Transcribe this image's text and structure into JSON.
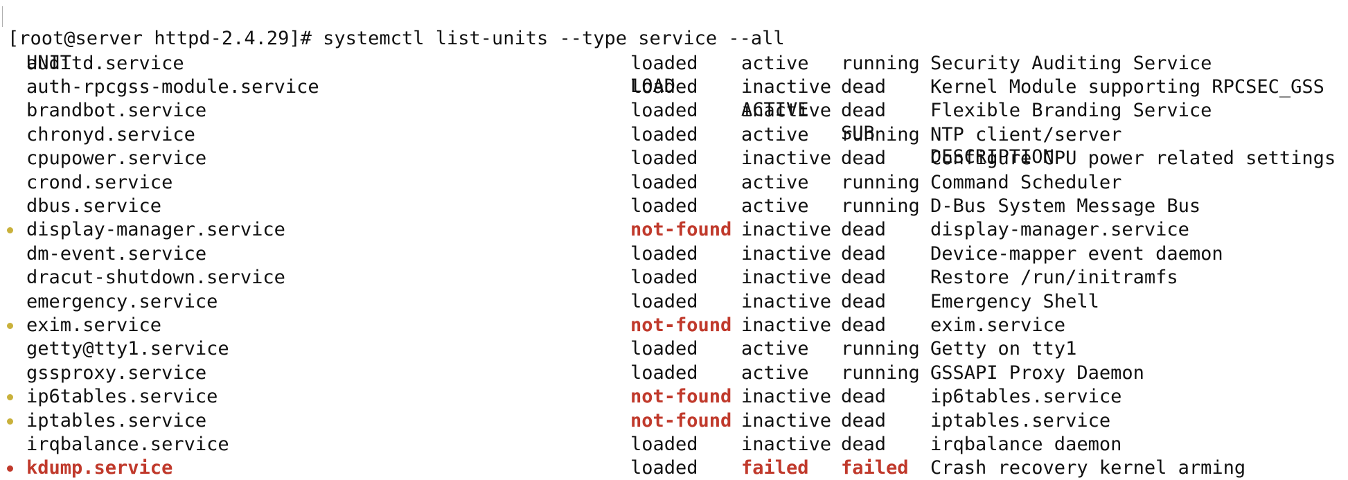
{
  "terminal": {
    "prompt": "[root@server httpd-2.4.29]# systemctl list-units --type service --all",
    "colors": {
      "text": "#111111",
      "error": "#c0392b",
      "warning_dot": "#c9b13b",
      "background": "#ffffff"
    },
    "headers": {
      "unit": "UNIT",
      "load": "LOAD",
      "active": "ACTIVE",
      "sub": "SUB",
      "description": "DESCRIPTION"
    },
    "rows": [
      {
        "unit": "auditd.service",
        "load": "loaded",
        "active": "active",
        "sub": "running",
        "description": "Security Auditing Service",
        "status": "ok"
      },
      {
        "unit": "auth-rpcgss-module.service",
        "load": "loaded",
        "active": "inactive",
        "sub": "dead",
        "description": "Kernel Module supporting RPCSEC_GSS",
        "status": "ok"
      },
      {
        "unit": "brandbot.service",
        "load": "loaded",
        "active": "inactive",
        "sub": "dead",
        "description": "Flexible Branding Service",
        "status": "ok"
      },
      {
        "unit": "chronyd.service",
        "load": "loaded",
        "active": "active",
        "sub": "running",
        "description": "NTP client/server",
        "status": "ok"
      },
      {
        "unit": "cpupower.service",
        "load": "loaded",
        "active": "inactive",
        "sub": "dead",
        "description": "Configure CPU power related settings",
        "status": "ok"
      },
      {
        "unit": "crond.service",
        "load": "loaded",
        "active": "active",
        "sub": "running",
        "description": "Command Scheduler",
        "status": "ok"
      },
      {
        "unit": "dbus.service",
        "load": "loaded",
        "active": "active",
        "sub": "running",
        "description": "D-Bus System Message Bus",
        "status": "ok"
      },
      {
        "unit": "display-manager.service",
        "load": "not-found",
        "active": "inactive",
        "sub": "dead",
        "description": "display-manager.service",
        "status": "not-found"
      },
      {
        "unit": "dm-event.service",
        "load": "loaded",
        "active": "inactive",
        "sub": "dead",
        "description": "Device-mapper event daemon",
        "status": "ok"
      },
      {
        "unit": "dracut-shutdown.service",
        "load": "loaded",
        "active": "inactive",
        "sub": "dead",
        "description": "Restore /run/initramfs",
        "status": "ok"
      },
      {
        "unit": "emergency.service",
        "load": "loaded",
        "active": "inactive",
        "sub": "dead",
        "description": "Emergency Shell",
        "status": "ok"
      },
      {
        "unit": "exim.service",
        "load": "not-found",
        "active": "inactive",
        "sub": "dead",
        "description": "exim.service",
        "status": "not-found"
      },
      {
        "unit": "getty@tty1.service",
        "load": "loaded",
        "active": "active",
        "sub": "running",
        "description": "Getty on tty1",
        "status": "ok"
      },
      {
        "unit": "gssproxy.service",
        "load": "loaded",
        "active": "active",
        "sub": "running",
        "description": "GSSAPI Proxy Daemon",
        "status": "ok"
      },
      {
        "unit": "ip6tables.service",
        "load": "not-found",
        "active": "inactive",
        "sub": "dead",
        "description": "ip6tables.service",
        "status": "not-found"
      },
      {
        "unit": "iptables.service",
        "load": "not-found",
        "active": "inactive",
        "sub": "dead",
        "description": "iptables.service",
        "status": "not-found"
      },
      {
        "unit": "irqbalance.service",
        "load": "loaded",
        "active": "inactive",
        "sub": "dead",
        "description": "irqbalance daemon",
        "status": "ok"
      },
      {
        "unit": "kdump.service",
        "load": "loaded",
        "active": "failed",
        "sub": "failed",
        "description": "Crash recovery kernel arming",
        "status": "failed"
      }
    ]
  }
}
